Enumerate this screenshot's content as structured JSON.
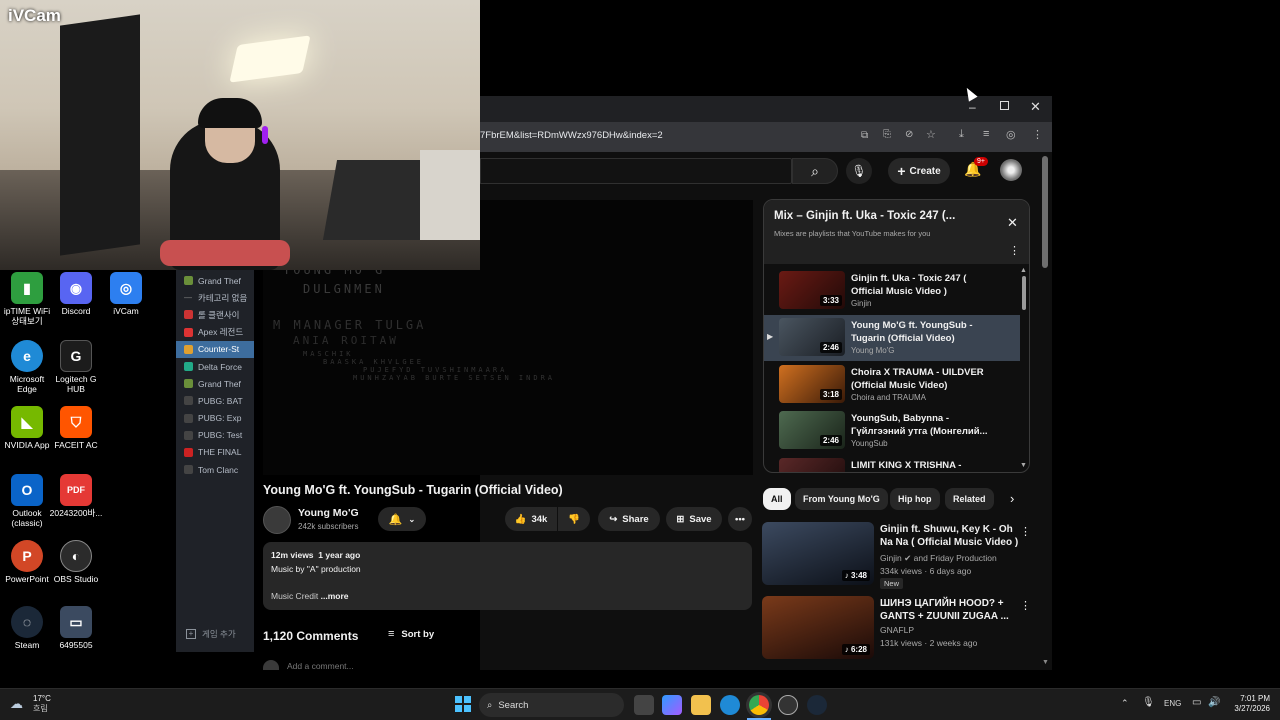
{
  "webcam": {
    "label": "iVCam"
  },
  "desktop_icons": [
    {
      "label": "ipTIME WiFi 상태보기",
      "color": "#2e9e3f",
      "glyph": "▮"
    },
    {
      "label": "Discord",
      "color": "#5865f2",
      "glyph": "◉"
    },
    {
      "label": "iVCam",
      "color": "#2d7ff0",
      "glyph": "◎"
    },
    {
      "label": "Microsoft Edge",
      "color": "#1f8ad6",
      "glyph": "e"
    },
    {
      "label": "Logitech G HUB",
      "color": "#1c1c1c",
      "glyph": "G"
    },
    {
      "label": "NVIDIA App",
      "color": "#76b900",
      "glyph": "◣"
    },
    {
      "label": "FACEIT AC",
      "color": "#ff5500",
      "glyph": "⛉"
    },
    {
      "label": "Outlook (classic)",
      "color": "#0a64c8",
      "glyph": "O"
    },
    {
      "label": "20243200바...",
      "color": "#e53935",
      "glyph": "PDF"
    },
    {
      "label": "PowerPoint",
      "color": "#d24726",
      "glyph": "P"
    },
    {
      "label": "OBS Studio",
      "color": "#2b2b2b",
      "glyph": "◐"
    },
    {
      "label": "Steam",
      "color": "#1b2838",
      "glyph": "◌"
    },
    {
      "label": "6495505",
      "color": "#3b4a60",
      "glyph": "▭"
    }
  ],
  "steam_library": {
    "items": [
      {
        "label": "Grand Thef",
        "color": "#6a8f3a"
      },
      {
        "label": "카테고리 없음",
        "color": ""
      },
      {
        "label": "롤 클랜사이",
        "color": "#c33"
      },
      {
        "label": "Apex 레전드",
        "color": "#d33"
      },
      {
        "label": "Counter-St",
        "color": "#e0a030",
        "active": true
      },
      {
        "label": "Delta Force",
        "color": "#2a8"
      },
      {
        "label": "Grand Thef",
        "color": "#6a8f3a"
      },
      {
        "label": "PUBG: BAT",
        "color": "#444"
      },
      {
        "label": "PUBG: Exp",
        "color": "#444"
      },
      {
        "label": "PUBG: Test",
        "color": "#444"
      },
      {
        "label": "THE FINAL",
        "color": "#c22"
      },
      {
        "label": "Tom Clanc",
        "color": "#444"
      }
    ],
    "add_game": "게임 추가"
  },
  "browser": {
    "url": "7FbrEM&list=RDmWWzx976DHw&index=2",
    "create_label": "Create",
    "notif_badge": "9+"
  },
  "video": {
    "title": "Young Mo'G ft. YoungSub - Tugarin (Official Video)",
    "channel": "Young Mo'G",
    "subscribers": "242k subscribers",
    "likes": "34k",
    "share": "Share",
    "save": "Save",
    "views": "12m views",
    "age": "1 year ago",
    "desc_line": "Music by \"A\" production",
    "desc_credit": "Music Credit",
    "more": "...more",
    "comments_count": "1,120 Comments",
    "sort_by": "Sort by",
    "add_comment": "Add a comment..."
  },
  "playlist": {
    "title": "Mix – Ginjin ft. Uka - Toxic 247 (...",
    "subtitle": "Mixes are playlists that YouTube makes for you",
    "items": [
      {
        "title": "Ginjin ft. Uka - Toxic 247 ( Official Music Video )",
        "channel": "Ginjin",
        "duration": "3:33",
        "thumb": "#6a1a14",
        "current": false
      },
      {
        "title": "Young Mo'G ft. YoungSub - Tugarin (Official Video)",
        "channel": "Young Mo'G",
        "duration": "2:46",
        "thumb": "#2a3038",
        "current": true
      },
      {
        "title": "Choira X TRAUMA - UILDVER (Official Music Video)",
        "channel": "Choira and TRAUMA",
        "duration": "3:18",
        "thumb": "#a0521a",
        "current": false
      },
      {
        "title": "YoungSub, Babynna - Гүйлгээний утга (Монгелий...",
        "channel": "YoungSub",
        "duration": "2:46",
        "thumb": "#3a4a3c",
        "current": false
      },
      {
        "title": "LIMIT KING X TRISHNA -",
        "channel": "",
        "duration": "",
        "thumb": "#3a2020",
        "current": false
      }
    ]
  },
  "chips": [
    "All",
    "From Young Mo'G",
    "Hip hop",
    "Related"
  ],
  "recommendations": [
    {
      "title": "Ginjin ft. Shuwu, Key K - Oh Na Na ( Official Music Video )",
      "channel": "Ginjin",
      "channel_extra": "and Friday Production",
      "meta": "334k views · 6 days ago",
      "badge": "New",
      "duration": "3:48",
      "thumb": "#1e2a3a"
    },
    {
      "title": "ШИНЭ ЦАГИЙН HOOD? + GANTS + ZUUNII ZUGAA ...",
      "channel": "GNAFLP",
      "channel_extra": "",
      "meta": "131k views · 2 weeks ago",
      "badge": "",
      "duration": "6:28",
      "thumb": "#5a2a1a"
    }
  ],
  "taskbar": {
    "weather_temp": "17°C",
    "weather_desc": "흐림",
    "search": "Search",
    "lang": "ENG",
    "time": "7:01 PM",
    "date": "3/27/2026"
  }
}
